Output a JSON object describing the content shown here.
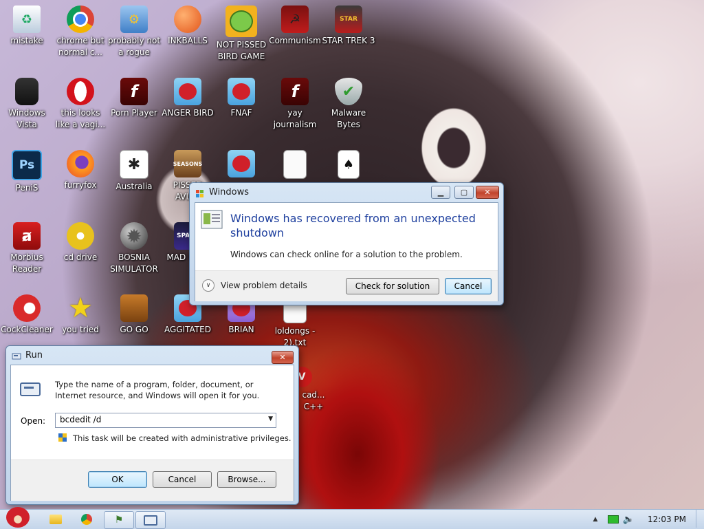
{
  "desktop": {
    "icons": [
      {
        "label": "mistake",
        "icon": "recycle-bin-icon"
      },
      {
        "label": "chrome but normal c...",
        "icon": "chrome-icon"
      },
      {
        "label": "probably not a rogue",
        "icon": "monitor-gears-icon"
      },
      {
        "label": "INKBALLS",
        "icon": "inkball-icon"
      },
      {
        "label": "NOT PISSED BIRD GAME",
        "icon": "green-pig-icon"
      },
      {
        "label": "Communism",
        "icon": "communism-emblem-icon"
      },
      {
        "label": "STAR TREK 3",
        "icon": "star-wars-angry-birds-icon"
      },
      {
        "label": "Windows Vista",
        "icon": "trash-can-icon"
      },
      {
        "label": "this looks like a vagi...",
        "icon": "opera-icon"
      },
      {
        "label": "Porn Player",
        "icon": "flash-player-icon"
      },
      {
        "label": "ANGER BIRD",
        "icon": "angry-bird-icon"
      },
      {
        "label": "FNAF",
        "icon": "angry-bird-icon"
      },
      {
        "label": "yay journalism",
        "icon": "flash-player-icon"
      },
      {
        "label": "Malware Bytes",
        "icon": "shield-check-icon"
      },
      {
        "label": "PeniS",
        "icon": "photoshop-icon"
      },
      {
        "label": "furryfox",
        "icon": "firefox-icon"
      },
      {
        "label": "Australia",
        "icon": "spider-solitaire-icon"
      },
      {
        "label": "PISSED AVIAN",
        "icon": "angry-birds-seasons-icon"
      },
      {
        "label": "",
        "icon": "angry-bird-icon"
      },
      {
        "label": "",
        "icon": "document-icon"
      },
      {
        "label": "",
        "icon": "solitaire-icon"
      },
      {
        "label": "Morbius Reader",
        "icon": "acrobat-reader-icon"
      },
      {
        "label": "cd drive",
        "icon": "cd-drive-icon"
      },
      {
        "label": "BOSNIA SIMULATOR",
        "icon": "mine-icon"
      },
      {
        "label": "MAD UNIV",
        "icon": "angry-birds-space-icon"
      },
      {
        "label": "CockCleaner",
        "icon": "ccleaner-icon"
      },
      {
        "label": "you tried",
        "icon": "star-icon"
      },
      {
        "label": "GO GO",
        "icon": "briefcase-icon"
      },
      {
        "label": "AGGITATED",
        "icon": "angry-bird-icon"
      },
      {
        "label": "BRIAN",
        "icon": "angry-birds-rio-icon"
      },
      {
        "label": "loldongs - 2).txt",
        "icon": "text-file-icon"
      },
      {
        "label": "cad... C++",
        "icon": "visual-cpp-icon"
      }
    ]
  },
  "problem_dialog": {
    "title": "Windows",
    "heading": "Windows has recovered from an unexpected shutdown",
    "body": "Windows can check online for a solution to the problem.",
    "details_label": "View problem details",
    "check_button": "Check for solution",
    "cancel_button": "Cancel"
  },
  "run_dialog": {
    "title": "Run",
    "description": "Type the name of a program, folder, document, or Internet resource, and Windows will open it for you.",
    "open_label": "Open:",
    "open_value": "bcdedit /d",
    "admin_note": "This task will be created with administrative privileges.",
    "ok_button": "OK",
    "cancel_button": "Cancel",
    "browse_button": "Browse..."
  },
  "taskbar": {
    "clock": "12:03 PM"
  }
}
